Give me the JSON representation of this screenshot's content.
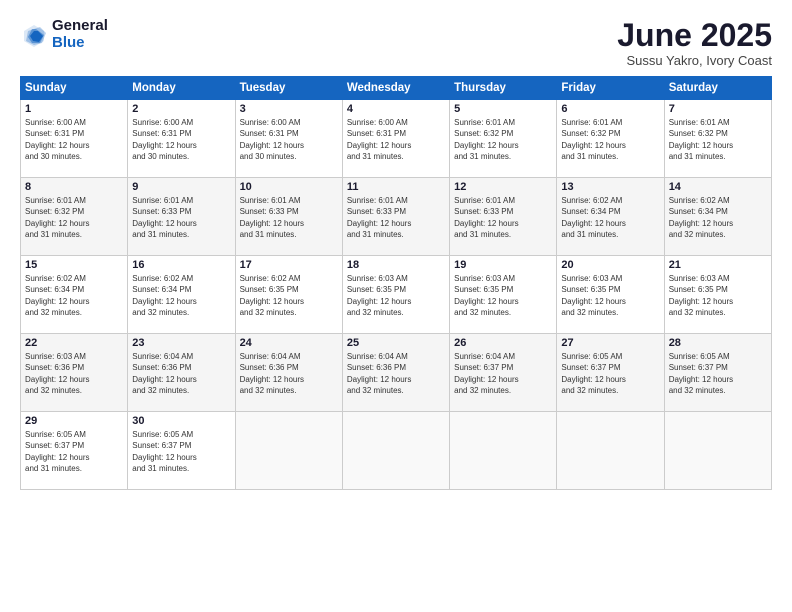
{
  "logo": {
    "general": "General",
    "blue": "Blue"
  },
  "title": "June 2025",
  "subtitle": "Sussu Yakro, Ivory Coast",
  "weekdays": [
    "Sunday",
    "Monday",
    "Tuesday",
    "Wednesday",
    "Thursday",
    "Friday",
    "Saturday"
  ],
  "weeks": [
    [
      {
        "day": "1",
        "info": "Sunrise: 6:00 AM\nSunset: 6:31 PM\nDaylight: 12 hours\nand 30 minutes."
      },
      {
        "day": "2",
        "info": "Sunrise: 6:00 AM\nSunset: 6:31 PM\nDaylight: 12 hours\nand 30 minutes."
      },
      {
        "day": "3",
        "info": "Sunrise: 6:00 AM\nSunset: 6:31 PM\nDaylight: 12 hours\nand 30 minutes."
      },
      {
        "day": "4",
        "info": "Sunrise: 6:00 AM\nSunset: 6:31 PM\nDaylight: 12 hours\nand 31 minutes."
      },
      {
        "day": "5",
        "info": "Sunrise: 6:01 AM\nSunset: 6:32 PM\nDaylight: 12 hours\nand 31 minutes."
      },
      {
        "day": "6",
        "info": "Sunrise: 6:01 AM\nSunset: 6:32 PM\nDaylight: 12 hours\nand 31 minutes."
      },
      {
        "day": "7",
        "info": "Sunrise: 6:01 AM\nSunset: 6:32 PM\nDaylight: 12 hours\nand 31 minutes."
      }
    ],
    [
      {
        "day": "8",
        "info": "Sunrise: 6:01 AM\nSunset: 6:32 PM\nDaylight: 12 hours\nand 31 minutes."
      },
      {
        "day": "9",
        "info": "Sunrise: 6:01 AM\nSunset: 6:33 PM\nDaylight: 12 hours\nand 31 minutes."
      },
      {
        "day": "10",
        "info": "Sunrise: 6:01 AM\nSunset: 6:33 PM\nDaylight: 12 hours\nand 31 minutes."
      },
      {
        "day": "11",
        "info": "Sunrise: 6:01 AM\nSunset: 6:33 PM\nDaylight: 12 hours\nand 31 minutes."
      },
      {
        "day": "12",
        "info": "Sunrise: 6:01 AM\nSunset: 6:33 PM\nDaylight: 12 hours\nand 31 minutes."
      },
      {
        "day": "13",
        "info": "Sunrise: 6:02 AM\nSunset: 6:34 PM\nDaylight: 12 hours\nand 31 minutes."
      },
      {
        "day": "14",
        "info": "Sunrise: 6:02 AM\nSunset: 6:34 PM\nDaylight: 12 hours\nand 32 minutes."
      }
    ],
    [
      {
        "day": "15",
        "info": "Sunrise: 6:02 AM\nSunset: 6:34 PM\nDaylight: 12 hours\nand 32 minutes."
      },
      {
        "day": "16",
        "info": "Sunrise: 6:02 AM\nSunset: 6:34 PM\nDaylight: 12 hours\nand 32 minutes."
      },
      {
        "day": "17",
        "info": "Sunrise: 6:02 AM\nSunset: 6:35 PM\nDaylight: 12 hours\nand 32 minutes."
      },
      {
        "day": "18",
        "info": "Sunrise: 6:03 AM\nSunset: 6:35 PM\nDaylight: 12 hours\nand 32 minutes."
      },
      {
        "day": "19",
        "info": "Sunrise: 6:03 AM\nSunset: 6:35 PM\nDaylight: 12 hours\nand 32 minutes."
      },
      {
        "day": "20",
        "info": "Sunrise: 6:03 AM\nSunset: 6:35 PM\nDaylight: 12 hours\nand 32 minutes."
      },
      {
        "day": "21",
        "info": "Sunrise: 6:03 AM\nSunset: 6:35 PM\nDaylight: 12 hours\nand 32 minutes."
      }
    ],
    [
      {
        "day": "22",
        "info": "Sunrise: 6:03 AM\nSunset: 6:36 PM\nDaylight: 12 hours\nand 32 minutes."
      },
      {
        "day": "23",
        "info": "Sunrise: 6:04 AM\nSunset: 6:36 PM\nDaylight: 12 hours\nand 32 minutes."
      },
      {
        "day": "24",
        "info": "Sunrise: 6:04 AM\nSunset: 6:36 PM\nDaylight: 12 hours\nand 32 minutes."
      },
      {
        "day": "25",
        "info": "Sunrise: 6:04 AM\nSunset: 6:36 PM\nDaylight: 12 hours\nand 32 minutes."
      },
      {
        "day": "26",
        "info": "Sunrise: 6:04 AM\nSunset: 6:37 PM\nDaylight: 12 hours\nand 32 minutes."
      },
      {
        "day": "27",
        "info": "Sunrise: 6:05 AM\nSunset: 6:37 PM\nDaylight: 12 hours\nand 32 minutes."
      },
      {
        "day": "28",
        "info": "Sunrise: 6:05 AM\nSunset: 6:37 PM\nDaylight: 12 hours\nand 32 minutes."
      }
    ],
    [
      {
        "day": "29",
        "info": "Sunrise: 6:05 AM\nSunset: 6:37 PM\nDaylight: 12 hours\nand 31 minutes."
      },
      {
        "day": "30",
        "info": "Sunrise: 6:05 AM\nSunset: 6:37 PM\nDaylight: 12 hours\nand 31 minutes."
      },
      {
        "day": "",
        "info": ""
      },
      {
        "day": "",
        "info": ""
      },
      {
        "day": "",
        "info": ""
      },
      {
        "day": "",
        "info": ""
      },
      {
        "day": "",
        "info": ""
      }
    ]
  ]
}
